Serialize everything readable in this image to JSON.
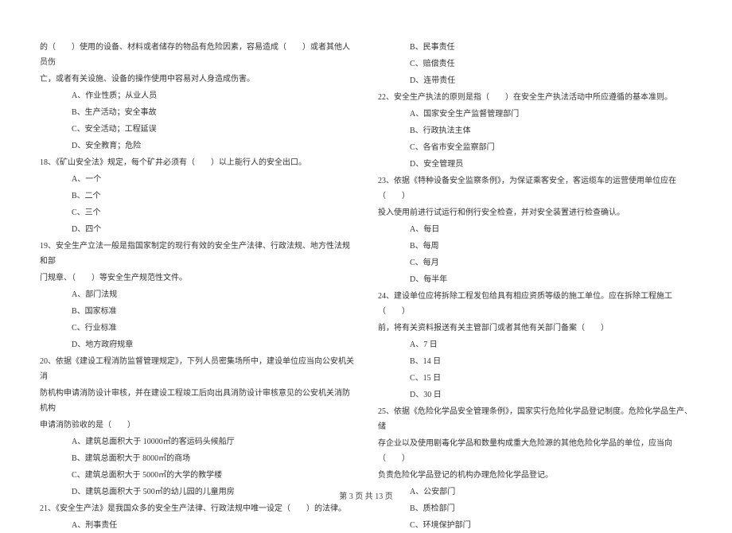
{
  "left": {
    "stem17a": "的（　　）使用的设备、材料或者储存的物品有危险因素，容易造成（　　）或者其他人员伤",
    "stem17b": "亡，或者有关设施、设备的操作使用中容易对人身造成伤害。",
    "q17a": "A、作业性质；从业人员",
    "q17b": "B、生产活动；安全事故",
    "q17c": "C、安全活动；工程延误",
    "q17d": "D、安全教育；危险",
    "stem18": "18、《矿山安全法》规定，每个矿井必须有（　　）以上能行人的安全出口。",
    "q18a": "A、一个",
    "q18b": "B、二个",
    "q18c": "C、三个",
    "q18d": "D、四个",
    "stem19a": "19、安全生产立法一般是指国家制定的现行有效的安全生产法律、行政法规、地方性法规和部",
    "stem19b": "门规章、（　　）等安全生产规范性文件。",
    "q19a": "A、部门法规",
    "q19b": "B、国家标准",
    "q19c": "C、行业标准",
    "q19d": "D、地方政府规章",
    "stem20a": "20、依据《建设工程消防监督管理规定》，下列人员密集场所中，建设单位应当向公安机关消",
    "stem20b": "防机构申请消防设计审核，并在建设工程竣工后向出具消防设计审核意见的公安机关消防机构",
    "stem20c": "申请消防验收的是（　　）",
    "q20a": "A、建筑总面积大于 10000㎡的客运码头候船厅",
    "q20b": "B、建筑总面积大于 8000㎡的商场",
    "q20c": "C、建筑总面积大于 5000㎡的大学的教学楼",
    "q20d": "D、建筑总面积大于 500㎡的幼儿园的儿童用房",
    "stem21": "21、《安全生产法》是我国众多的安全生产法律、行政法规中唯一设定（　　）的法律。",
    "q21a": "A、刑事责任"
  },
  "right": {
    "q21b": "B、民事责任",
    "q21c": "C、赔偿责任",
    "q21d": "D、连带责任",
    "stem22": "22、安全生产执法的原则是指（　　）在安全生产执法活动中所应遵循的基本准则。",
    "q22a": "A、国家安全生产监督管理部门",
    "q22b": "B、行政执法主体",
    "q22c": "C、各省市安全监察部门",
    "q22d": "D、安全管理员",
    "stem23a": "23、依据《特种设备安全监察条例》，为保证乘客安全，客运缆车的运营使用单位应在（　　）",
    "stem23b": "投入使用前进行试运行和例行安全检查，并对安全装置进行检查确认。",
    "q23a": "A、每日",
    "q23b": "B、每周",
    "q23c": "C、每月",
    "q23d": "D、每半年",
    "stem24a": "24、建设单位应将拆除工程发包给具有相应资质等级的施工单位。应在拆除工程施工（　　）",
    "stem24b": "前，将有关资料报送有关主管部门或者其他有关部门备案（　　）",
    "q24a": "A、7 日",
    "q24b": "B、14 日",
    "q24c": "C、15 日",
    "q24d": "D、30 日",
    "stem25a": "25、依据《危险化学品安全管理条例》，国家实行危险化学品登记制度。危险化学品生产、储",
    "stem25b": "存企业以及使用剧毒化学品和数量构成重大危险源的其他危险化学品的单位，应当向（　　）",
    "stem25c": "负责危险化学品登记的机构办理危险化学品登记。",
    "q25a": "A、公安部门",
    "q25b": "B、质检部门",
    "q25c": "C、环境保护部门"
  },
  "footer": "第 3 页 共 13 页"
}
